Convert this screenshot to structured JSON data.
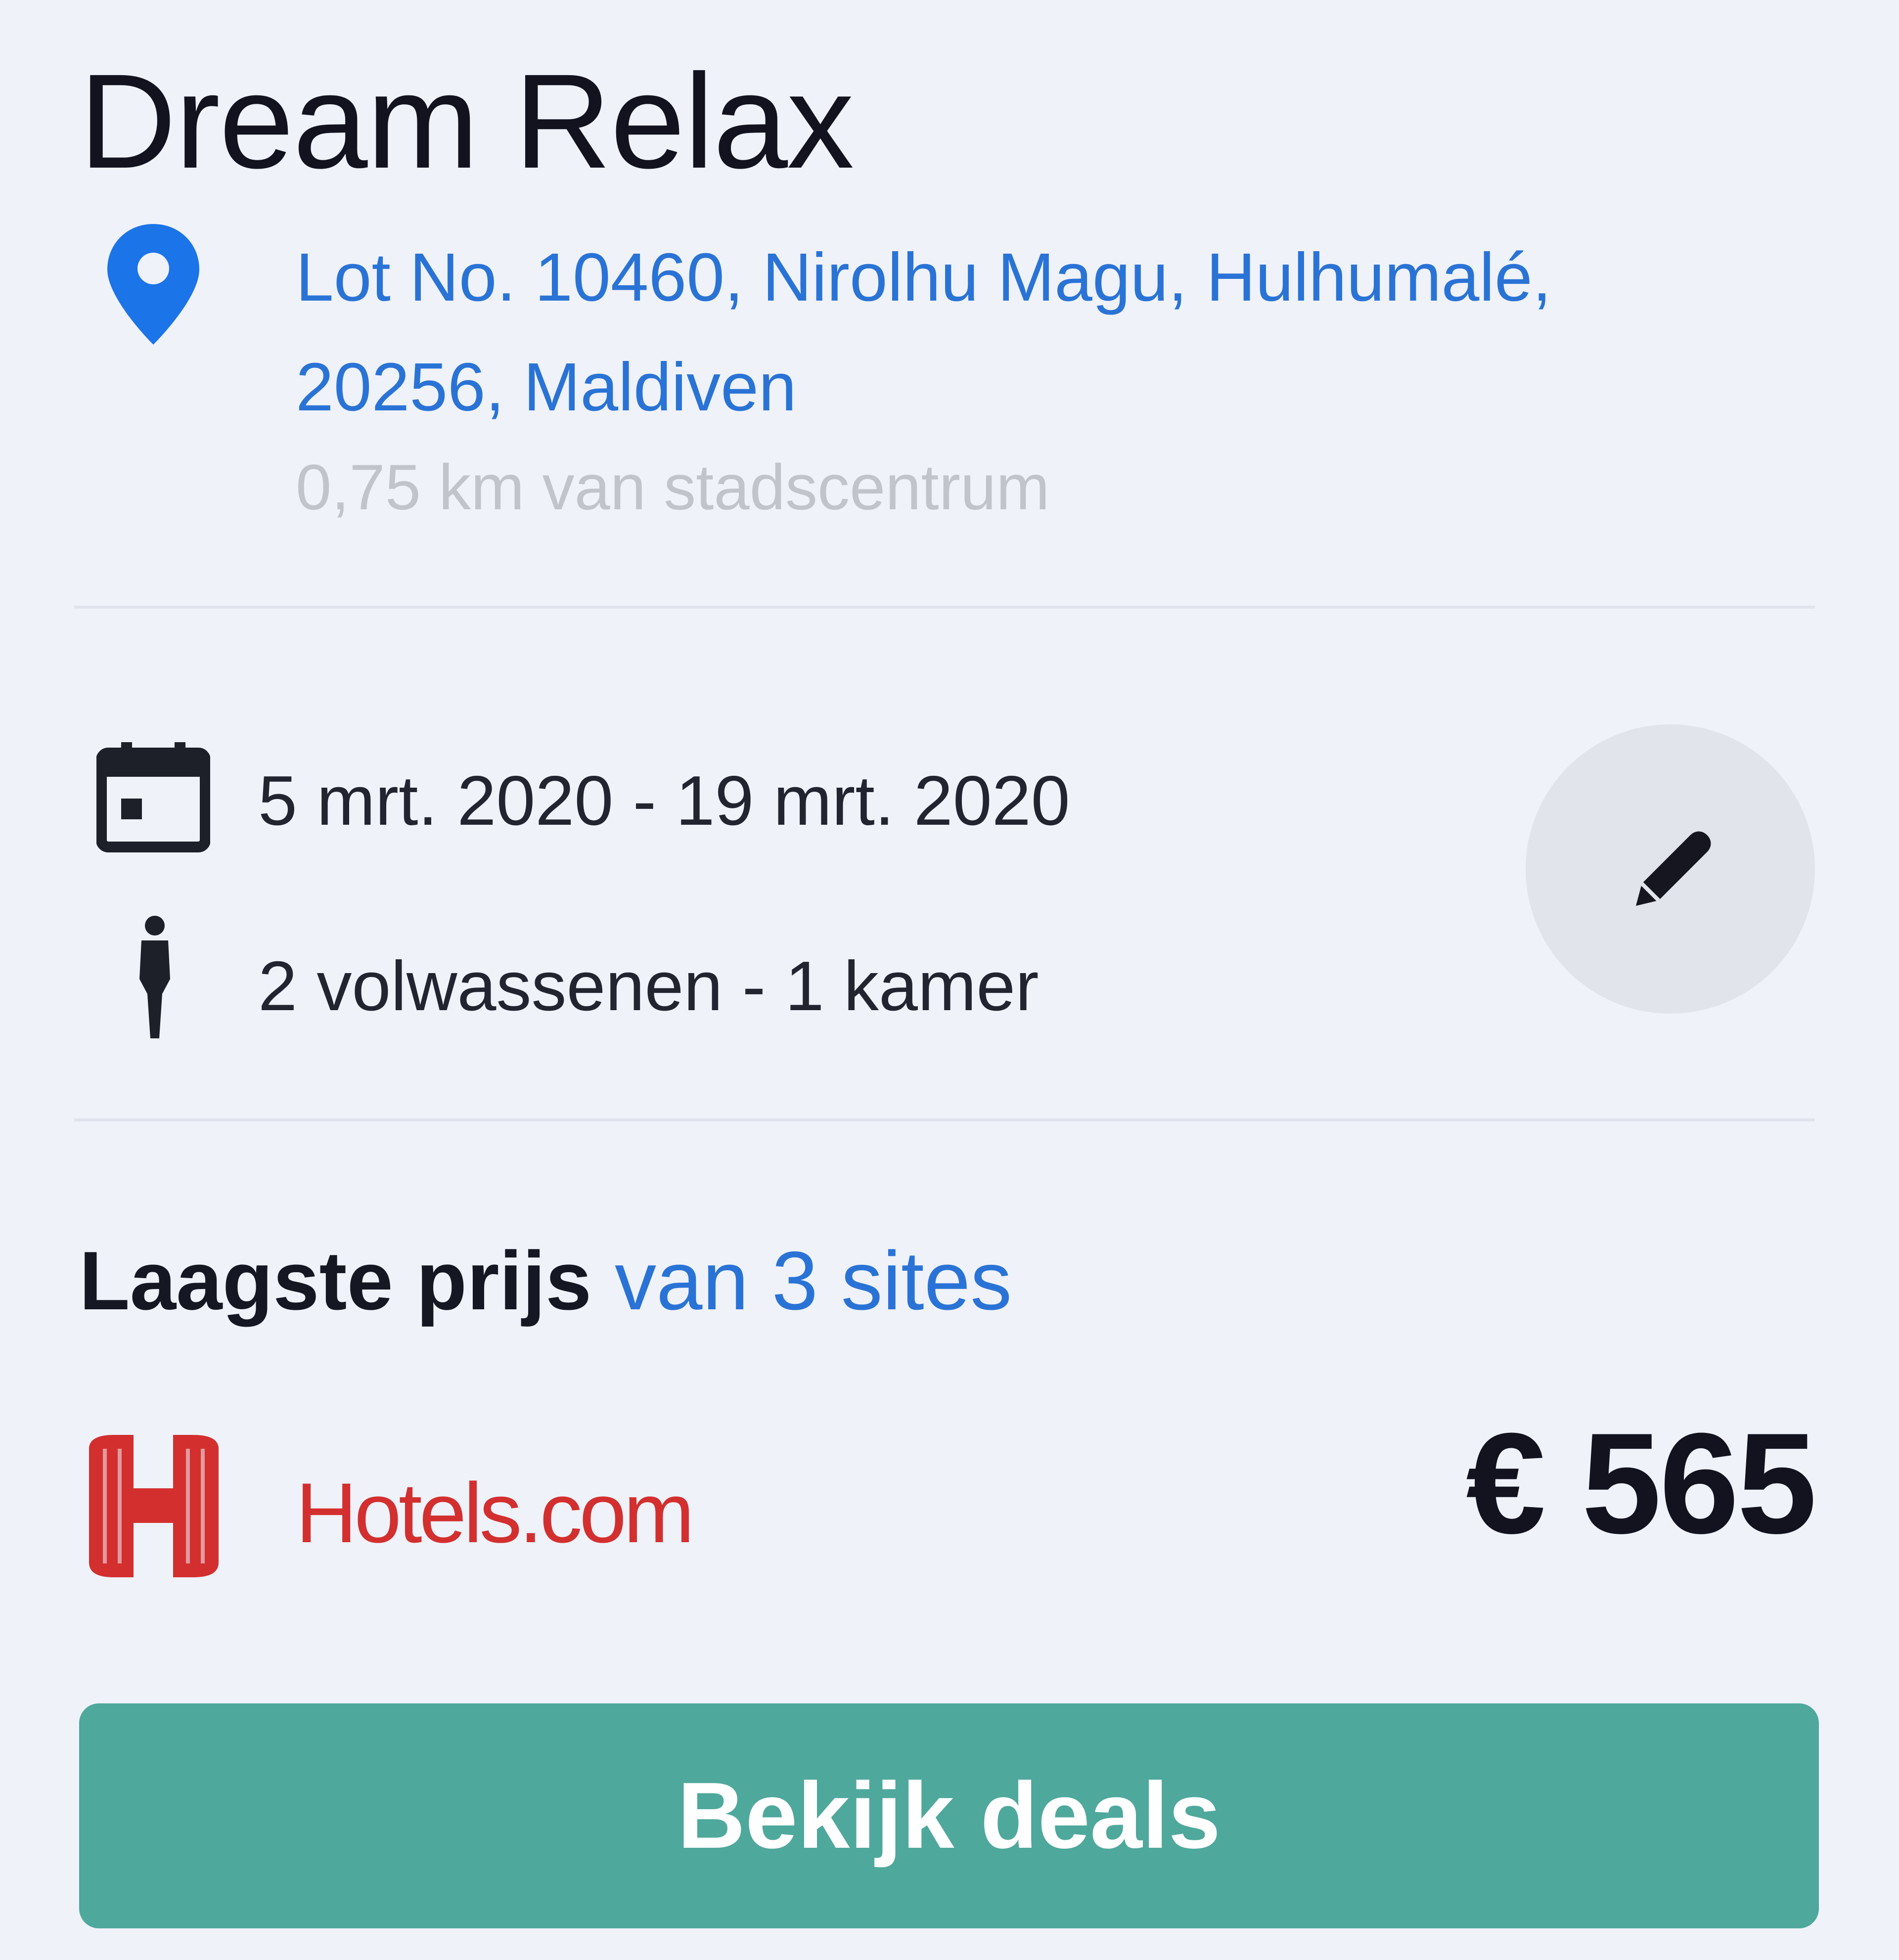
{
  "hotel": {
    "name": "Dream Relax",
    "address": "Lot No. 10460, Nirolhu Magu, Hulhumalé, 20256, Maldiven",
    "distance": "0,75 km van stadscentrum"
  },
  "stay": {
    "dates": "5 mrt. 2020 - 19 mrt. 2020",
    "guests": "2 volwassenen - 1 kamer"
  },
  "pricing": {
    "label": "Laagste prijs",
    "sites_link": "van 3 sites",
    "provider": "Hotels.com",
    "price": "€ 565",
    "cta_label": "Bekijk deals"
  },
  "icons": {
    "location": "map-pin-icon",
    "calendar": "calendar-icon",
    "person": "person-icon",
    "edit": "pencil-icon",
    "provider_logo": "hotels-com-logo"
  },
  "colors": {
    "background": "#eff2f9",
    "link_blue": "#2a73d6",
    "pin_blue": "#1b74e8",
    "hotels_red": "#d32f2f",
    "cta_green": "#4fa89c"
  }
}
